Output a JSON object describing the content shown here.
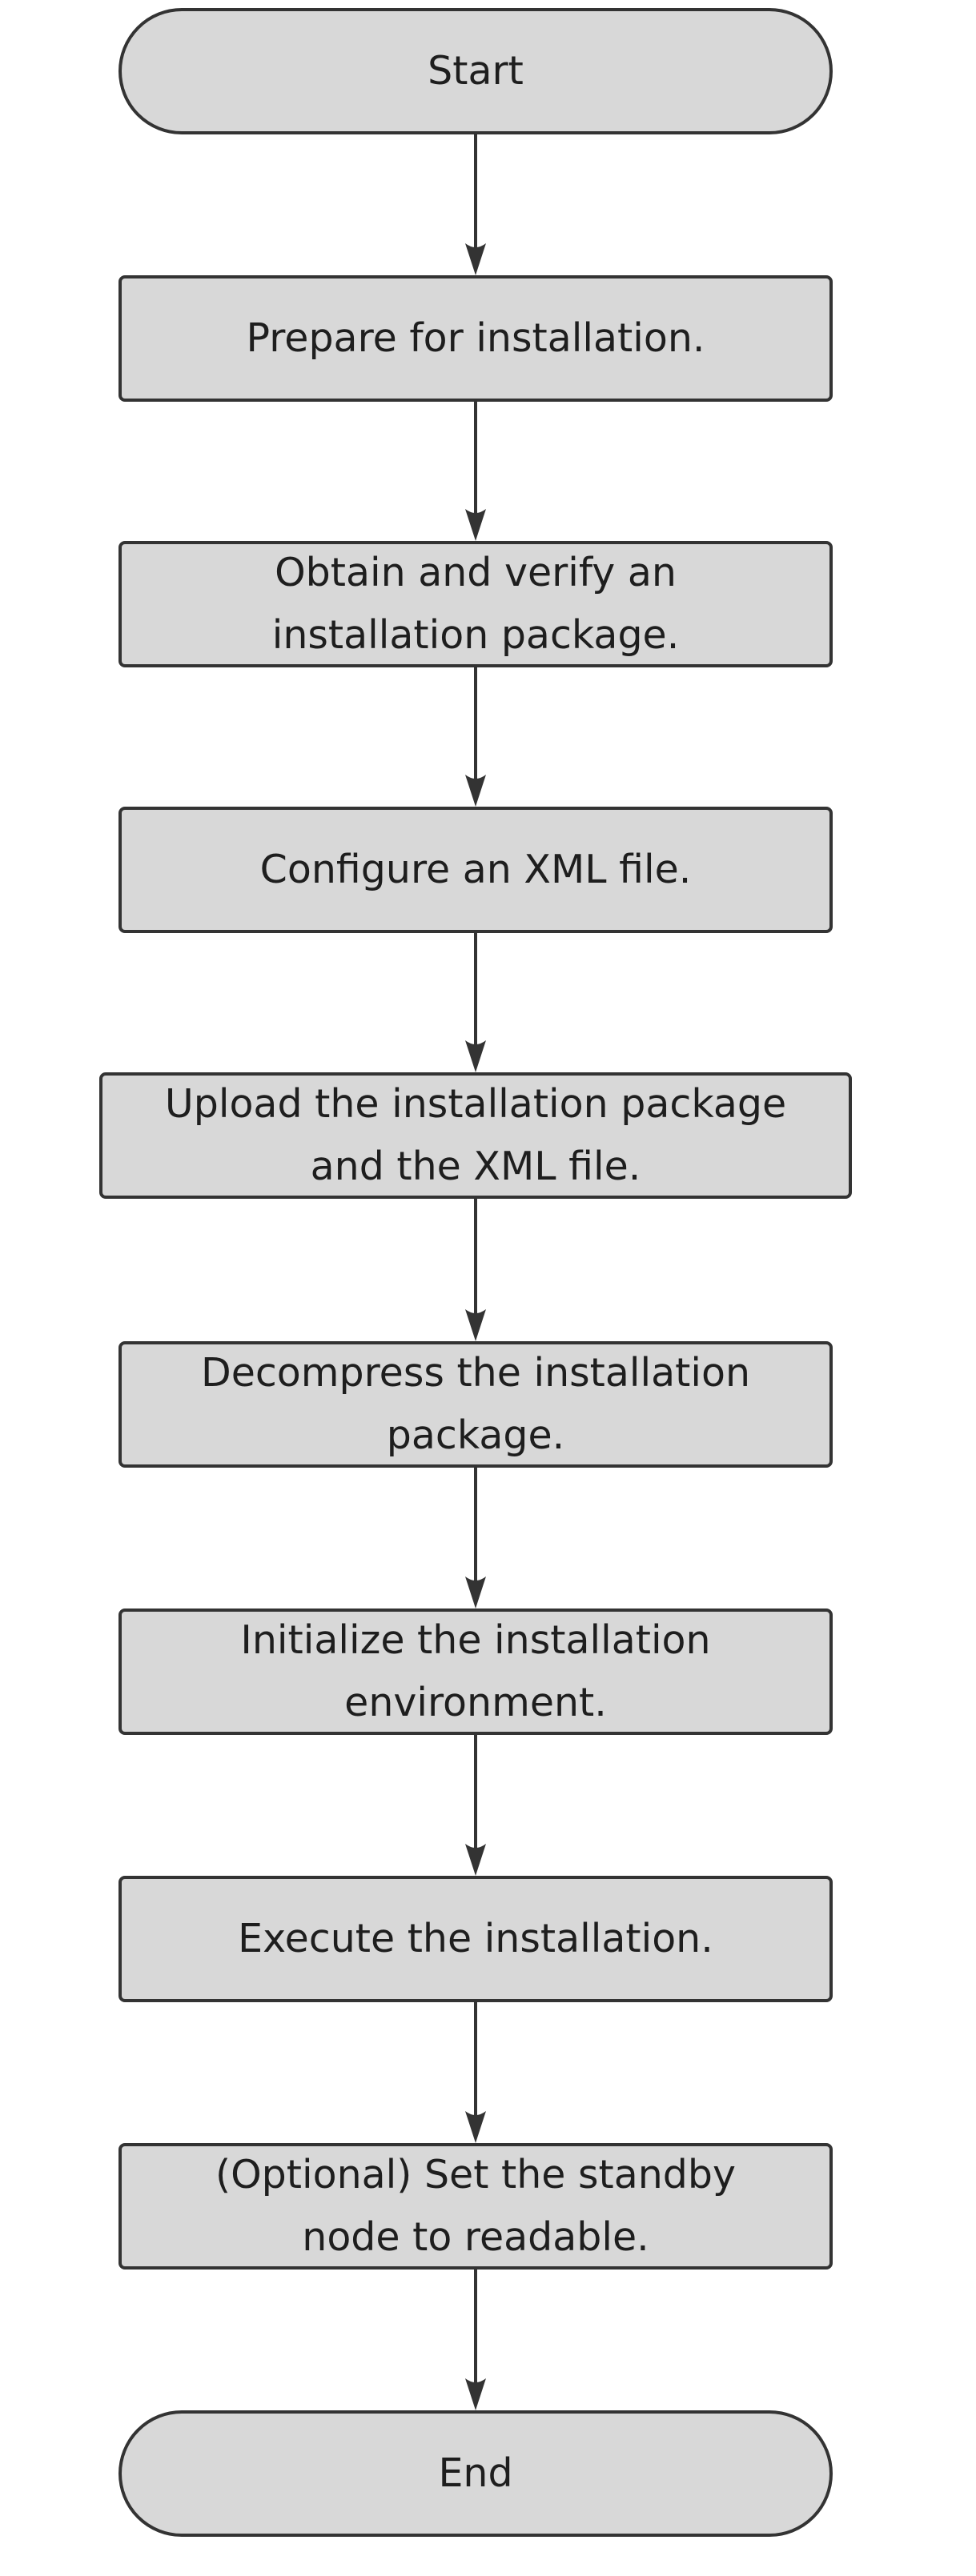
{
  "diagram": {
    "type": "flowchart",
    "direction": "top-to-bottom",
    "colors": {
      "node_fill": "#d8d8d8",
      "node_stroke": "#333333",
      "text": "#1e1e1e",
      "arrow": "#333333",
      "background": "#ffffff"
    },
    "nodes": [
      {
        "id": "start",
        "shape": "terminal",
        "label": "Start"
      },
      {
        "id": "prepare",
        "shape": "process",
        "label": "Prepare for installation."
      },
      {
        "id": "obtain",
        "shape": "process",
        "label": "Obtain and verify an installation package."
      },
      {
        "id": "configure",
        "shape": "process",
        "label": "Configure an XML file."
      },
      {
        "id": "upload",
        "shape": "process",
        "label": "Upload the installation package and the XML file."
      },
      {
        "id": "decompress",
        "shape": "process",
        "label": "Decompress the installation package."
      },
      {
        "id": "initialize",
        "shape": "process",
        "label": "Initialize the installation environment."
      },
      {
        "id": "execute",
        "shape": "process",
        "label": "Execute the installation."
      },
      {
        "id": "optional",
        "shape": "process",
        "label": "(Optional) Set the standby node to readable."
      },
      {
        "id": "end",
        "shape": "terminal",
        "label": "End"
      }
    ],
    "edges": [
      {
        "from": "start",
        "to": "prepare"
      },
      {
        "from": "prepare",
        "to": "obtain"
      },
      {
        "from": "obtain",
        "to": "configure"
      },
      {
        "from": "configure",
        "to": "upload"
      },
      {
        "from": "upload",
        "to": "decompress"
      },
      {
        "from": "decompress",
        "to": "initialize"
      },
      {
        "from": "initialize",
        "to": "execute"
      },
      {
        "from": "execute",
        "to": "optional"
      },
      {
        "from": "optional",
        "to": "end"
      }
    ]
  }
}
